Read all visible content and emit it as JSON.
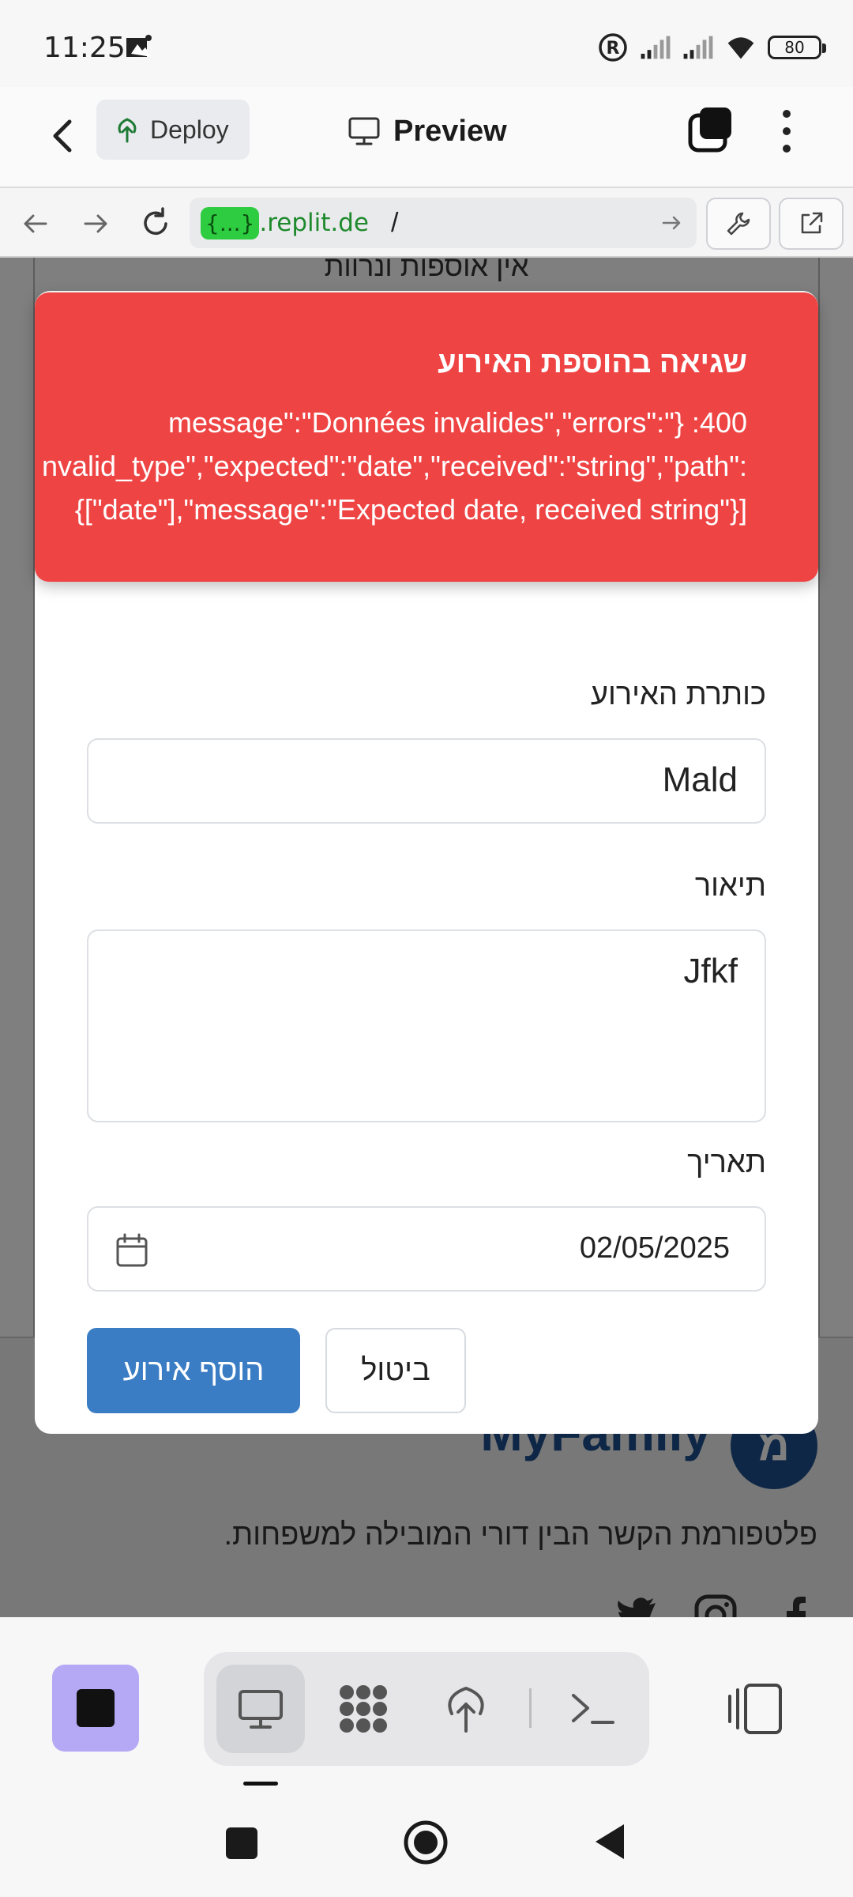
{
  "status_bar": {
    "time": "11:25",
    "battery": "80"
  },
  "header": {
    "deploy_label": "Deploy",
    "preview_label": "Preview"
  },
  "url_bar": {
    "host_badge": "{...}",
    "host": ".replit.de",
    "path": "/"
  },
  "background_page": {
    "top_text": "אין אוספות ונרוות",
    "brand_logo": "מ",
    "brand_name": "MyFamily",
    "tagline": "פלטפורמת הקשר הבין דורי המובילה למשפחות."
  },
  "toast": {
    "title": "שגיאה בהוספת האירוע",
    "lines": [
      "message\":\"Données invalides\",\"errors\":\"} :400",
      "nvalid_type\",\"expected\":\"date\",\"received\":\"string\",\"path\":",
      "{[\"date\"],\"message\":\"Expected date, received string\"}]"
    ]
  },
  "form": {
    "title_label": "כותרת האירוע",
    "title_value": "Mald",
    "description_label": "תיאור",
    "description_value": "Jfkf",
    "date_label": "תאריך",
    "date_value": "02/05/2025",
    "submit_label": "הוסף אירוע",
    "cancel_label": "ביטול"
  },
  "colors": {
    "toast_bg": "#ef4444",
    "primary_button": "#3b7dc4",
    "brand_blue": "#1e4f8c",
    "stop_button": "#b5a8f5",
    "url_badge": "#2ecc40"
  },
  "icons": [
    "back-icon",
    "deploy-icon",
    "monitor-icon",
    "tabs-icon",
    "kebab-icon",
    "nav-back-icon",
    "nav-forward-icon",
    "reload-icon",
    "go-arrow-icon",
    "wrench-icon",
    "external-link-icon",
    "calendar-icon",
    "stop-icon",
    "preview-icon",
    "workflow-icon",
    "deploy-tool-icon",
    "terminal-icon",
    "panel-icon"
  ]
}
